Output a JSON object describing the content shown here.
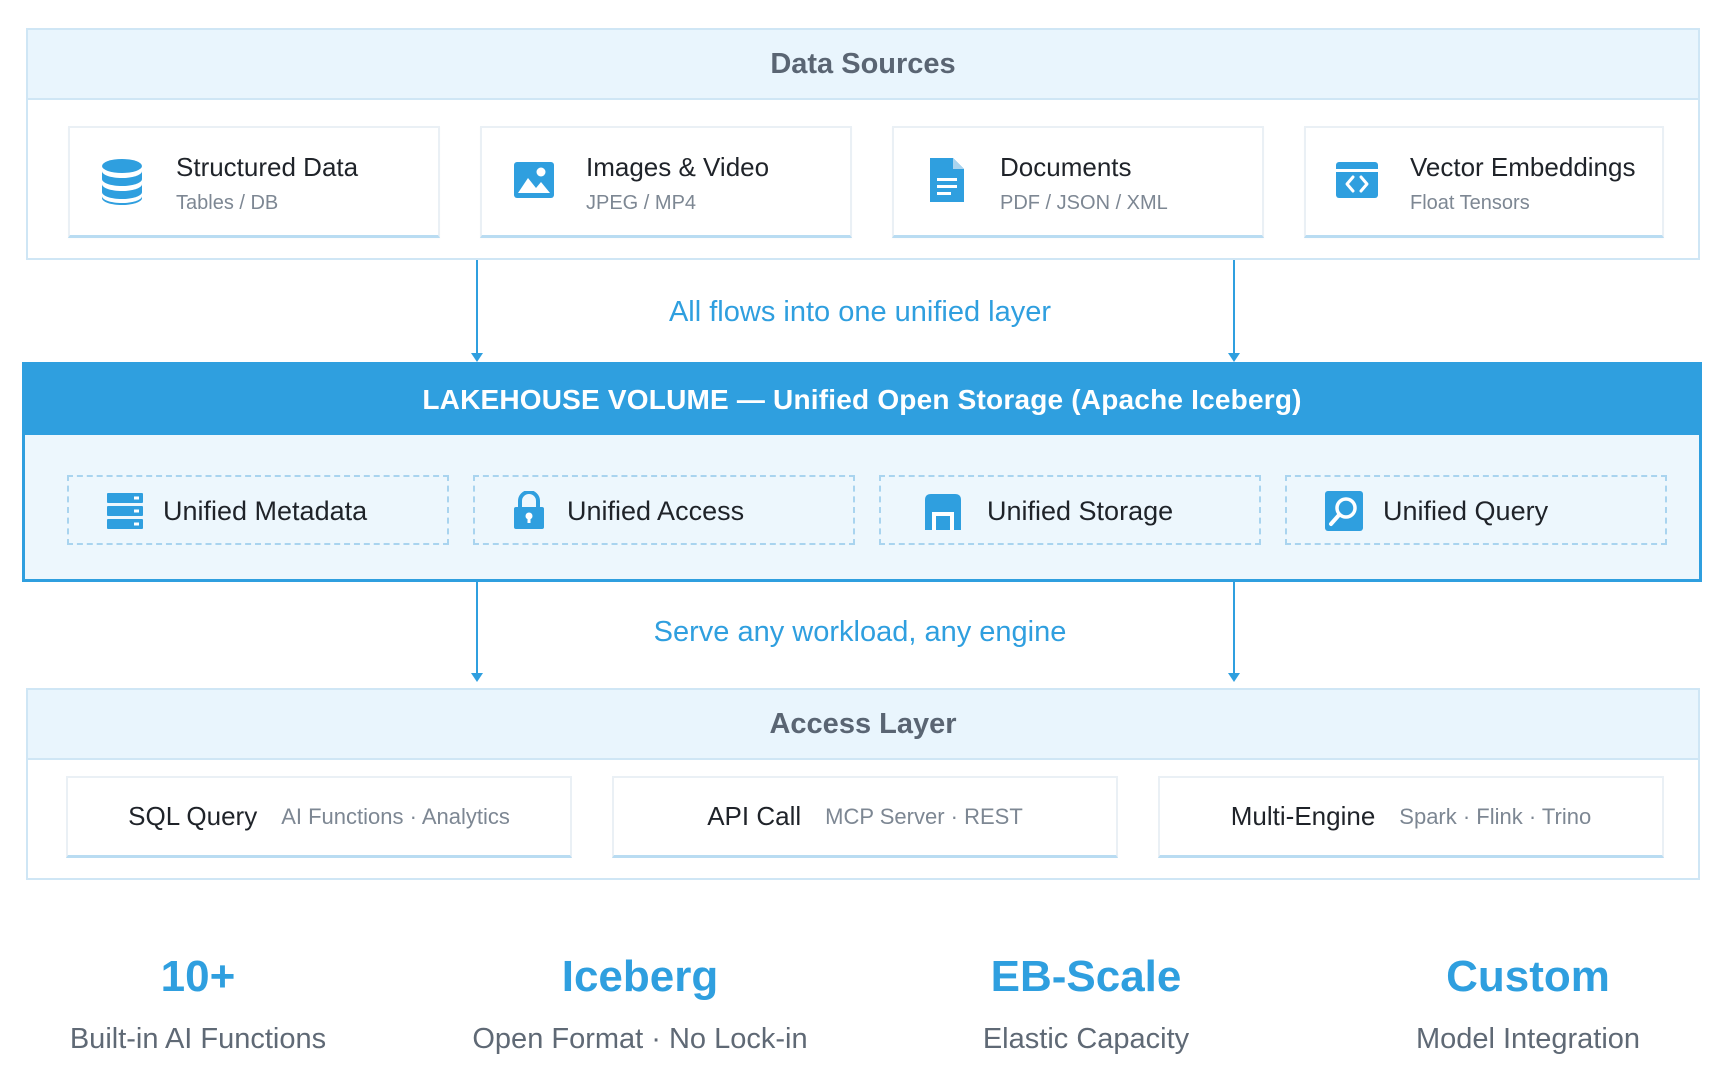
{
  "data_sources": {
    "title": "Data Sources",
    "items": [
      {
        "title": "Structured Data",
        "subtitle": "Tables / DB",
        "icon": "database-icon"
      },
      {
        "title": "Images & Video",
        "subtitle": "JPEG / MP4",
        "icon": "image-icon"
      },
      {
        "title": "Documents",
        "subtitle": "PDF / JSON / XML",
        "icon": "document-icon"
      },
      {
        "title": "Vector Embeddings",
        "subtitle": "Float Tensors",
        "icon": "code-window-icon"
      }
    ]
  },
  "flow_top_label": "All flows into one unified layer",
  "lakehouse": {
    "title": "LAKEHOUSE VOLUME — Unified Open Storage (Apache Iceberg)",
    "features": [
      {
        "label": "Unified Metadata",
        "icon": "server-stack-icon"
      },
      {
        "label": "Unified Access",
        "icon": "lock-icon"
      },
      {
        "label": "Unified Storage",
        "icon": "storage-icon"
      },
      {
        "label": "Unified Query",
        "icon": "search-icon"
      }
    ]
  },
  "flow_bottom_label": "Serve any workload, any engine",
  "access_layer": {
    "title": "Access Layer",
    "items": [
      {
        "title": "SQL Query",
        "subtitle": "AI Functions · Analytics"
      },
      {
        "title": "API Call",
        "subtitle": "MCP Server · REST"
      },
      {
        "title": "Multi-Engine",
        "subtitle": "Spark · Flink · Trino"
      }
    ]
  },
  "stats": [
    {
      "value": "10+",
      "label": "Built-in AI Functions"
    },
    {
      "value": "Iceberg",
      "label": "Open Format · No Lock-in"
    },
    {
      "value": "EB-Scale",
      "label": "Elastic Capacity"
    },
    {
      "value": "Custom",
      "label": "Model Integration"
    }
  ],
  "colors": {
    "accent": "#2f9fdf",
    "panel_header_bg": "#e9f5fd",
    "panel_border": "#cfe6f5",
    "lake_body_bg": "#edf7fd"
  }
}
